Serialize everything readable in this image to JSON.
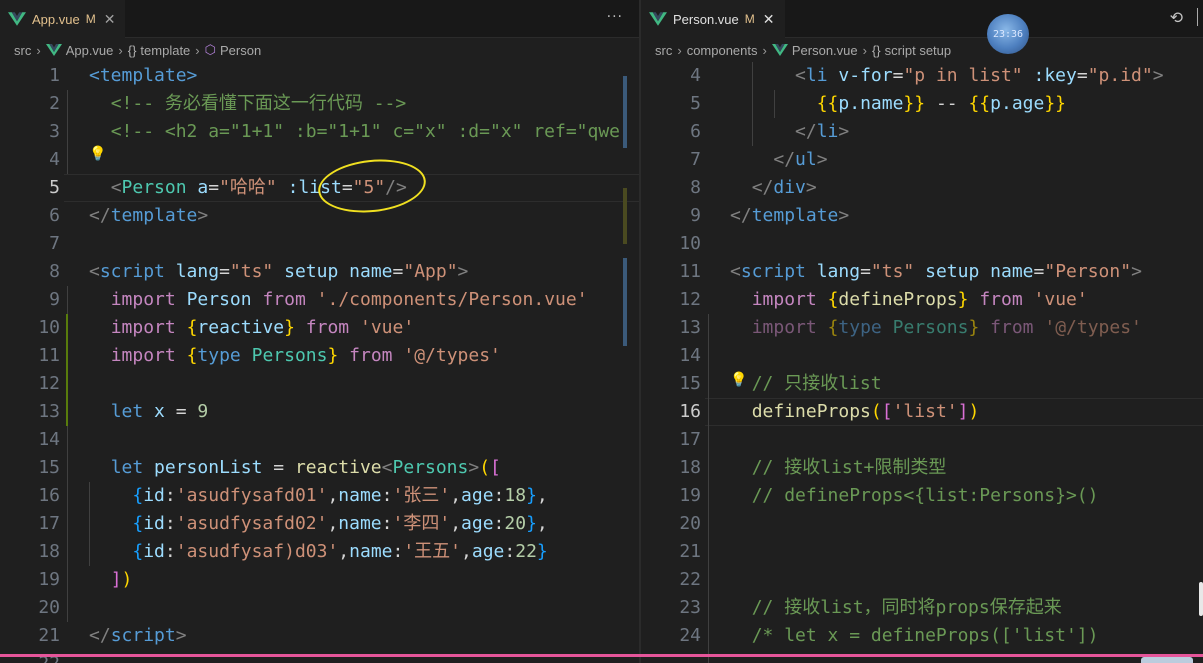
{
  "left": {
    "tab": {
      "name": "App.vue",
      "status": "M"
    },
    "more_label": "···",
    "breadcrumb": {
      "src": "src",
      "file": "App.vue",
      "section": "template",
      "component": "Person"
    },
    "lines": [
      {
        "n": "1",
        "t": [
          [
            "tg",
            "<template>"
          ]
        ]
      },
      {
        "n": "2",
        "t": [
          [
            "tx",
            "  "
          ],
          [
            "cm",
            "<!-- 务必看懂下面这一行代码 -->"
          ]
        ]
      },
      {
        "n": "3",
        "t": [
          [
            "tx",
            "  "
          ],
          [
            "cm",
            "<!-- <h2 a=\"1+1\" :b=\"1+1\" c=\"x\" :d=\"x\" ref=\"qwe"
          ]
        ]
      },
      {
        "n": "4",
        "t": []
      },
      {
        "n": "5",
        "t": [
          [
            "tx",
            "  "
          ],
          [
            "br",
            "<"
          ],
          [
            "ty",
            "Person"
          ],
          [
            "tx",
            " "
          ],
          [
            "at",
            "a"
          ],
          [
            "tx",
            "="
          ],
          [
            "st",
            "\"哈哈\""
          ],
          [
            "tx",
            " "
          ],
          [
            "at",
            ":list"
          ],
          [
            "tx",
            "="
          ],
          [
            "st",
            "\"5\""
          ],
          [
            "br",
            "/>"
          ]
        ]
      },
      {
        "n": "6",
        "t": [
          [
            "br",
            "</"
          ],
          [
            "tg",
            "template"
          ],
          [
            "br",
            ">"
          ]
        ]
      },
      {
        "n": "7",
        "t": []
      },
      {
        "n": "8",
        "t": [
          [
            "br",
            "<"
          ],
          [
            "tg",
            "script"
          ],
          [
            "tx",
            " "
          ],
          [
            "at",
            "lang"
          ],
          [
            "tx",
            "="
          ],
          [
            "st",
            "\"ts\""
          ],
          [
            "tx",
            " "
          ],
          [
            "at",
            "setup"
          ],
          [
            "tx",
            " "
          ],
          [
            "at",
            "name"
          ],
          [
            "tx",
            "="
          ],
          [
            "st",
            "\"App\""
          ],
          [
            "br",
            ">"
          ]
        ]
      },
      {
        "n": "9",
        "t": [
          [
            "tx",
            "  "
          ],
          [
            "kw",
            "import"
          ],
          [
            "tx",
            " "
          ],
          [
            "at",
            "Person"
          ],
          [
            "tx",
            " "
          ],
          [
            "kw",
            "from"
          ],
          [
            "tx",
            " "
          ],
          [
            "st",
            "'./components/Person.vue'"
          ]
        ]
      },
      {
        "n": "10",
        "t": [
          [
            "tx",
            "  "
          ],
          [
            "kw",
            "import"
          ],
          [
            "tx",
            " "
          ],
          [
            "y1",
            "{"
          ],
          [
            "at",
            "reactive"
          ],
          [
            "y1",
            "}"
          ],
          [
            "tx",
            " "
          ],
          [
            "kw",
            "from"
          ],
          [
            "tx",
            " "
          ],
          [
            "st",
            "'vue'"
          ]
        ]
      },
      {
        "n": "11",
        "t": [
          [
            "tx",
            "  "
          ],
          [
            "kw",
            "import"
          ],
          [
            "tx",
            " "
          ],
          [
            "y1",
            "{"
          ],
          [
            "kb",
            "type"
          ],
          [
            "tx",
            " "
          ],
          [
            "ty",
            "Persons"
          ],
          [
            "y1",
            "}"
          ],
          [
            "tx",
            " "
          ],
          [
            "kw",
            "from"
          ],
          [
            "tx",
            " "
          ],
          [
            "st",
            "'@/types'"
          ]
        ]
      },
      {
        "n": "12",
        "t": []
      },
      {
        "n": "13",
        "t": [
          [
            "tx",
            "  "
          ],
          [
            "kb",
            "let"
          ],
          [
            "tx",
            " "
          ],
          [
            "at",
            "x"
          ],
          [
            "tx",
            " = "
          ],
          [
            "nu",
            "9"
          ]
        ]
      },
      {
        "n": "14",
        "t": []
      },
      {
        "n": "15",
        "t": [
          [
            "tx",
            "  "
          ],
          [
            "kb",
            "let"
          ],
          [
            "tx",
            " "
          ],
          [
            "at",
            "personList"
          ],
          [
            "tx",
            " = "
          ],
          [
            "fn",
            "reactive"
          ],
          [
            "br",
            "<"
          ],
          [
            "ty",
            "Persons"
          ],
          [
            "br",
            ">"
          ],
          [
            "y1",
            "("
          ],
          [
            "p2",
            "["
          ]
        ]
      },
      {
        "n": "16",
        "t": [
          [
            "tx",
            "    "
          ],
          [
            "b3",
            "{"
          ],
          [
            "at",
            "id"
          ],
          [
            "tx",
            ":"
          ],
          [
            "st",
            "'asudfysafd01'"
          ],
          [
            "tx",
            ","
          ],
          [
            "at",
            "name"
          ],
          [
            "tx",
            ":"
          ],
          [
            "st",
            "'张三'"
          ],
          [
            "tx",
            ","
          ],
          [
            "at",
            "age"
          ],
          [
            "tx",
            ":"
          ],
          [
            "nu",
            "18"
          ],
          [
            "b3",
            "}"
          ],
          [
            "tx",
            ","
          ]
        ]
      },
      {
        "n": "17",
        "t": [
          [
            "tx",
            "    "
          ],
          [
            "b3",
            "{"
          ],
          [
            "at",
            "id"
          ],
          [
            "tx",
            ":"
          ],
          [
            "st",
            "'asudfysafd02'"
          ],
          [
            "tx",
            ","
          ],
          [
            "at",
            "name"
          ],
          [
            "tx",
            ":"
          ],
          [
            "st",
            "'李四'"
          ],
          [
            "tx",
            ","
          ],
          [
            "at",
            "age"
          ],
          [
            "tx",
            ":"
          ],
          [
            "nu",
            "20"
          ],
          [
            "b3",
            "}"
          ],
          [
            "tx",
            ","
          ]
        ]
      },
      {
        "n": "18",
        "t": [
          [
            "tx",
            "    "
          ],
          [
            "b3",
            "{"
          ],
          [
            "at",
            "id"
          ],
          [
            "tx",
            ":"
          ],
          [
            "st",
            "'asudfysaf)d03'"
          ],
          [
            "tx",
            ","
          ],
          [
            "at",
            "name"
          ],
          [
            "tx",
            ":"
          ],
          [
            "st",
            "'王五'"
          ],
          [
            "tx",
            ","
          ],
          [
            "at",
            "age"
          ],
          [
            "tx",
            ":"
          ],
          [
            "nu",
            "22"
          ],
          [
            "b3",
            "}"
          ]
        ]
      },
      {
        "n": "19",
        "t": [
          [
            "tx",
            "  "
          ],
          [
            "p2",
            "]"
          ],
          [
            "y1",
            ")"
          ]
        ]
      },
      {
        "n": "20",
        "t": []
      },
      {
        "n": "21",
        "t": [
          [
            "br",
            "</"
          ],
          [
            "tg",
            "script"
          ],
          [
            "br",
            ">"
          ]
        ]
      },
      {
        "n": "22",
        "t": []
      }
    ]
  },
  "right": {
    "tab": {
      "name": "Person.vue",
      "status": "M"
    },
    "clock": "23:36",
    "breadcrumb": {
      "src": "src",
      "folder": "components",
      "file": "Person.vue",
      "section": "script setup"
    },
    "lines": [
      {
        "n": "4",
        "t": [
          [
            "tx",
            "      "
          ],
          [
            "br",
            "<"
          ],
          [
            "tg",
            "li"
          ],
          [
            "tx",
            " "
          ],
          [
            "at",
            "v-for"
          ],
          [
            "tx",
            "="
          ],
          [
            "st",
            "\"p in list\""
          ],
          [
            "tx",
            " "
          ],
          [
            "at",
            ":key"
          ],
          [
            "tx",
            "="
          ],
          [
            "st",
            "\"p.id\""
          ],
          [
            "br",
            ">"
          ]
        ]
      },
      {
        "n": "5",
        "t": [
          [
            "tx",
            "        "
          ],
          [
            "y1",
            "{{"
          ],
          [
            "at",
            "p.name"
          ],
          [
            "y1",
            "}}"
          ],
          [
            "tx",
            " -- "
          ],
          [
            "y1",
            "{{"
          ],
          [
            "at",
            "p.age"
          ],
          [
            "y1",
            "}}"
          ]
        ]
      },
      {
        "n": "6",
        "t": [
          [
            "tx",
            "      "
          ],
          [
            "br",
            "</"
          ],
          [
            "tg",
            "li"
          ],
          [
            "br",
            ">"
          ]
        ]
      },
      {
        "n": "7",
        "t": [
          [
            "tx",
            "    "
          ],
          [
            "br",
            "</"
          ],
          [
            "tg",
            "ul"
          ],
          [
            "br",
            ">"
          ]
        ]
      },
      {
        "n": "8",
        "t": [
          [
            "tx",
            "  "
          ],
          [
            "br",
            "</"
          ],
          [
            "tg",
            "div"
          ],
          [
            "br",
            ">"
          ]
        ]
      },
      {
        "n": "9",
        "t": [
          [
            "br",
            "</"
          ],
          [
            "tg",
            "template"
          ],
          [
            "br",
            ">"
          ]
        ]
      },
      {
        "n": "10",
        "t": []
      },
      {
        "n": "11",
        "t": [
          [
            "br",
            "<"
          ],
          [
            "tg",
            "script"
          ],
          [
            "tx",
            " "
          ],
          [
            "at",
            "lang"
          ],
          [
            "tx",
            "="
          ],
          [
            "st",
            "\"ts\""
          ],
          [
            "tx",
            " "
          ],
          [
            "at",
            "setup"
          ],
          [
            "tx",
            " "
          ],
          [
            "at",
            "name"
          ],
          [
            "tx",
            "="
          ],
          [
            "st",
            "\"Person\""
          ],
          [
            "br",
            ">"
          ]
        ]
      },
      {
        "n": "12",
        "t": [
          [
            "tx",
            "  "
          ],
          [
            "kw",
            "import"
          ],
          [
            "tx",
            " "
          ],
          [
            "y1",
            "{"
          ],
          [
            "fn",
            "defineProps"
          ],
          [
            "y1",
            "}"
          ],
          [
            "tx",
            " "
          ],
          [
            "kw",
            "from"
          ],
          [
            "tx",
            " "
          ],
          [
            "st",
            "'vue'"
          ]
        ]
      },
      {
        "n": "13",
        "dim": true,
        "t": [
          [
            "tx",
            "  "
          ],
          [
            "kw",
            "import"
          ],
          [
            "tx",
            " "
          ],
          [
            "y1",
            "{"
          ],
          [
            "kb",
            "type"
          ],
          [
            "tx",
            " "
          ],
          [
            "ty",
            "Persons"
          ],
          [
            "y1",
            "}"
          ],
          [
            "tx",
            " "
          ],
          [
            "kw",
            "from"
          ],
          [
            "tx",
            " "
          ],
          [
            "st",
            "'@/types'"
          ]
        ]
      },
      {
        "n": "14",
        "t": []
      },
      {
        "n": "15",
        "t": [
          [
            "tx",
            "  "
          ],
          [
            "cm",
            "// 只接收list"
          ]
        ]
      },
      {
        "n": "16",
        "t": [
          [
            "tx",
            "  "
          ],
          [
            "fn",
            "defineProps"
          ],
          [
            "y1",
            "("
          ],
          [
            "p2",
            "["
          ],
          [
            "st",
            "'list'"
          ],
          [
            "p2",
            "]"
          ],
          [
            "y1",
            ")"
          ]
        ]
      },
      {
        "n": "17",
        "t": []
      },
      {
        "n": "18",
        "t": [
          [
            "tx",
            "  "
          ],
          [
            "cm",
            "// 接收list+限制类型"
          ]
        ]
      },
      {
        "n": "19",
        "t": [
          [
            "tx",
            "  "
          ],
          [
            "cm",
            "// defineProps<{list:Persons}>()"
          ]
        ]
      },
      {
        "n": "20",
        "t": []
      },
      {
        "n": "21",
        "t": []
      },
      {
        "n": "22",
        "t": []
      },
      {
        "n": "23",
        "t": [
          [
            "tx",
            "  "
          ],
          [
            "cm",
            "// 接收list，同时将props保存起来"
          ]
        ]
      },
      {
        "n": "24",
        "t": [
          [
            "tx",
            "  "
          ],
          [
            "cm",
            "/* let x = defineProps(['list'])"
          ]
        ]
      }
    ]
  }
}
